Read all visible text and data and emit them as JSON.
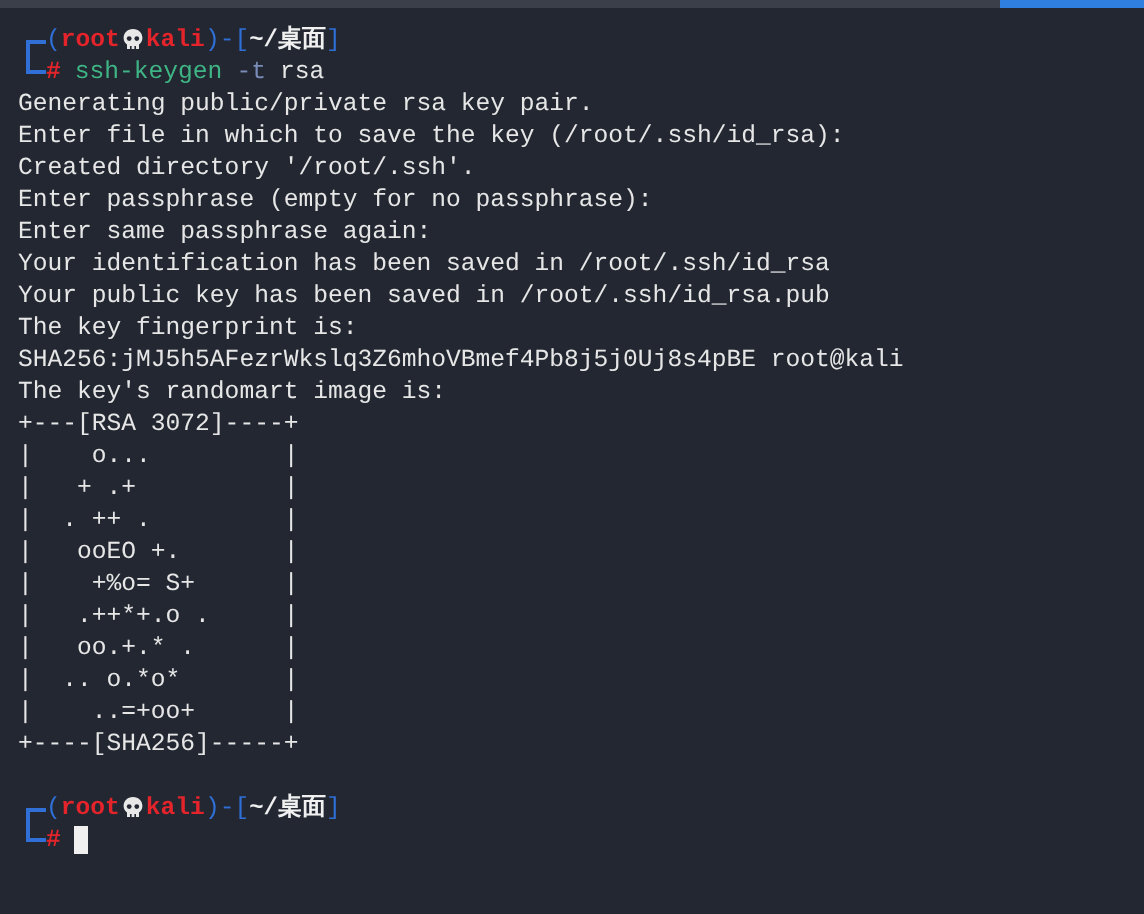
{
  "prompts": [
    {
      "open": "(",
      "user": "root",
      "host": "kali",
      "mid": ")-[",
      "path": "~/桌面",
      "close": "]",
      "symbol": "#",
      "command": [
        {
          "text": "ssh-keygen",
          "kind": "command"
        },
        {
          "text": "-t",
          "kind": "option"
        },
        {
          "text": "rsa",
          "kind": "argument"
        }
      ]
    },
    {
      "open": "(",
      "user": "root",
      "host": "kali",
      "mid": ")-[",
      "path": "~/桌面",
      "close": "]",
      "symbol": "#",
      "cursor": true
    }
  ],
  "output": [
    "Generating public/private rsa key pair.",
    "Enter file in which to save the key (/root/.ssh/id_rsa):",
    "Created directory '/root/.ssh'.",
    "Enter passphrase (empty for no passphrase):",
    "Enter same passphrase again:",
    "Your identification has been saved in /root/.ssh/id_rsa",
    "Your public key has been saved in /root/.ssh/id_rsa.pub",
    "The key fingerprint is:",
    "SHA256:jMJ5h5AFezrWkslq3Z6mhoVBmef4Pb8j5j0Uj8s4pBE root@kali",
    "The key's randomart image is:",
    "+---[RSA 3072]----+",
    "|    o...         |",
    "|   + .+          |",
    "|  . ++ .         |",
    "|   ooEO +.       |",
    "|    +%o= S+      |",
    "|   .++*+.o .     |",
    "|   oo.+.* .      |",
    "|  .. o.*o*       |",
    "|    ..=+oo+      |",
    "+----[SHA256]-----+"
  ]
}
